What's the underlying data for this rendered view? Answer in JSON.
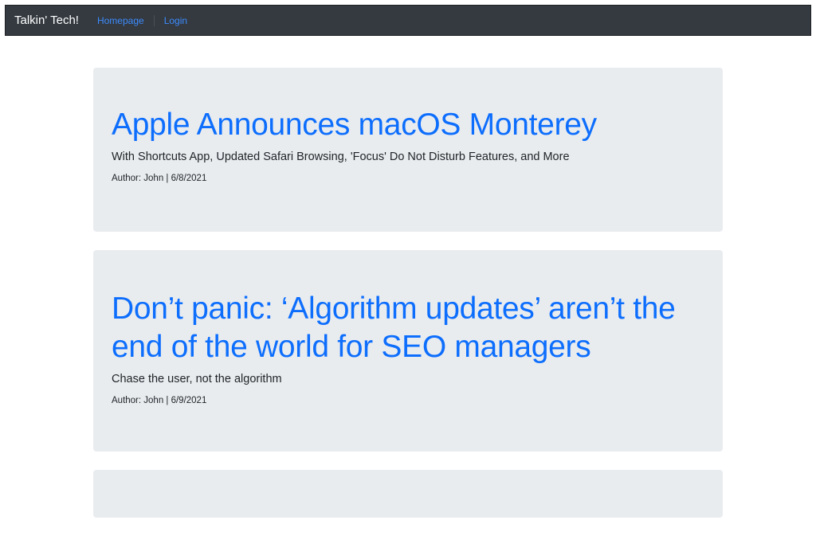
{
  "navbar": {
    "brand": "Talkin' Tech!",
    "links": [
      "Homepage",
      "Login"
    ]
  },
  "posts": [
    {
      "title": "Apple Announces macOS Monterey",
      "subtitle": "With Shortcuts App, Updated Safari Browsing, 'Focus' Do Not Disturb Features, and More",
      "byline": "Author: John | 6/8/2021"
    },
    {
      "title": "Don’t panic: ‘Algorithm updates’ aren’t the end of the world for SEO managers",
      "subtitle": "Chase the user, not the algorithm",
      "byline": "Author: John | 6/9/2021"
    }
  ]
}
